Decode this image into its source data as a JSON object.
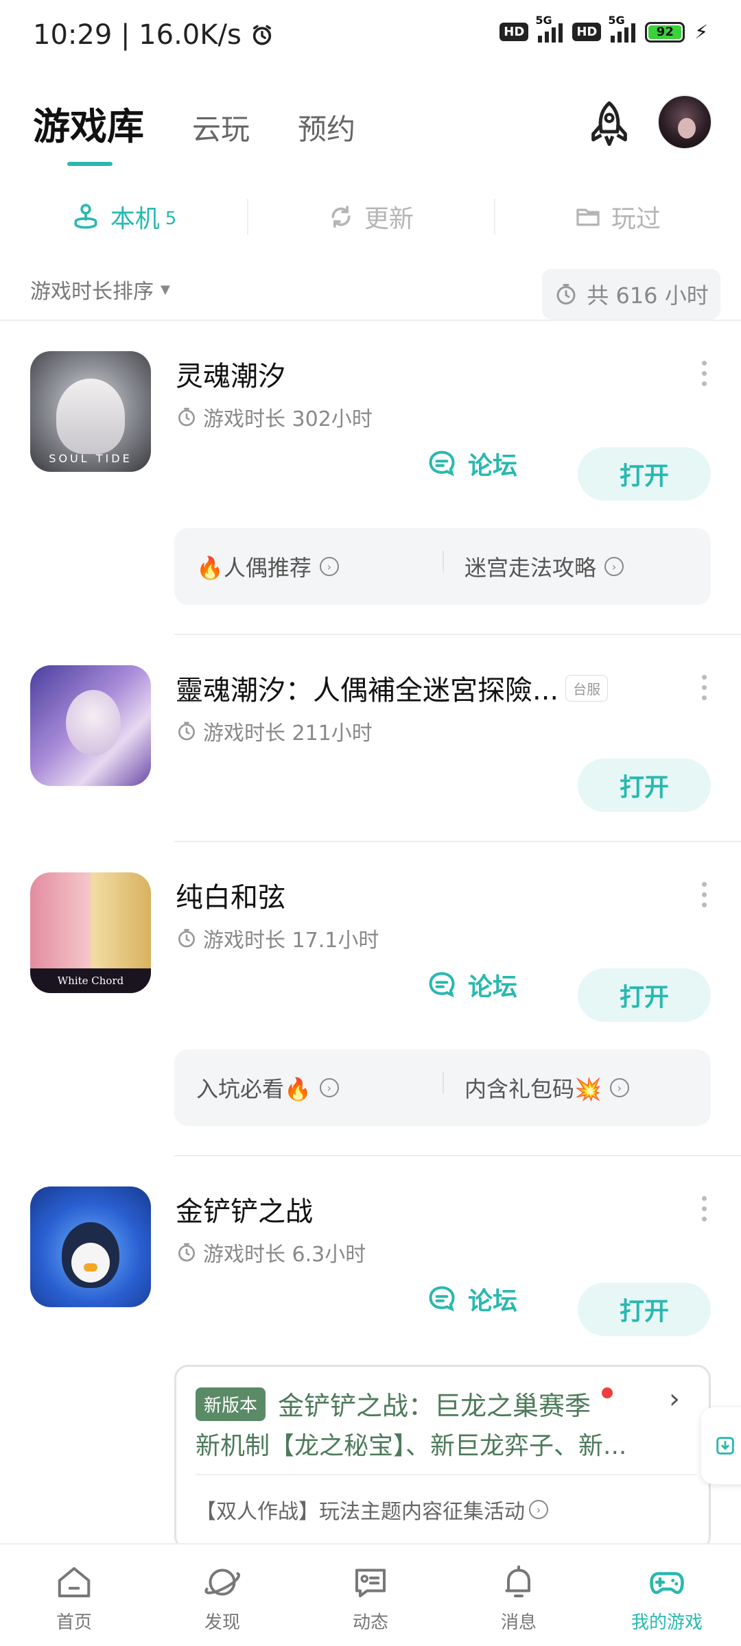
{
  "status_bar": {
    "time_speed": "10:29 | 16.0K/s",
    "alarm_icon": "alarm-icon",
    "hd_1": "HD",
    "net_1": "5G",
    "hd_2": "HD",
    "net_2": "5G",
    "battery": "92"
  },
  "header": {
    "tabs": [
      "游戏库",
      "云玩",
      "预约"
    ],
    "active_tab": 0
  },
  "subtabs": {
    "local": {
      "label": "本机",
      "count": "5"
    },
    "update": {
      "label": "更新"
    },
    "played": {
      "label": "玩过"
    }
  },
  "sort": {
    "label": "游戏时长排序",
    "total": "共 616 小时"
  },
  "games": [
    {
      "name": "灵魂潮汐",
      "playtime": "游戏时长 302小时",
      "forum_label": "论坛",
      "open_label": "打开",
      "tips": [
        "🔥人偶推荐",
        "迷宫走法攻略"
      ]
    },
    {
      "name": "靈魂潮汐：人偶補全迷宮探險...",
      "tag": "台服",
      "playtime": "游戏时长 211小时",
      "open_label": "打开"
    },
    {
      "name": "纯白和弦",
      "playtime": "游戏时长 17.1小时",
      "forum_label": "论坛",
      "open_label": "打开",
      "tips": [
        "入坑必看🔥",
        "内含礼包码💥"
      ]
    },
    {
      "name": "金铲铲之战",
      "playtime": "游戏时长 6.3小时",
      "forum_label": "论坛",
      "open_label": "打开"
    }
  ],
  "news": {
    "badge": "新版本",
    "title": "金铲铲之战：巨龙之巢赛季",
    "subtitle": "新机制【龙之秘宝】、新巨龙弈子、新...",
    "activity": "【双人作战】玩法主题内容征集活动"
  },
  "bottom_nav": {
    "items": [
      "首页",
      "发现",
      "动态",
      "消息",
      "我的游戏"
    ],
    "active": 4
  },
  "colors": {
    "accent": "#29b8b0",
    "news_green": "#4d7a5a"
  }
}
